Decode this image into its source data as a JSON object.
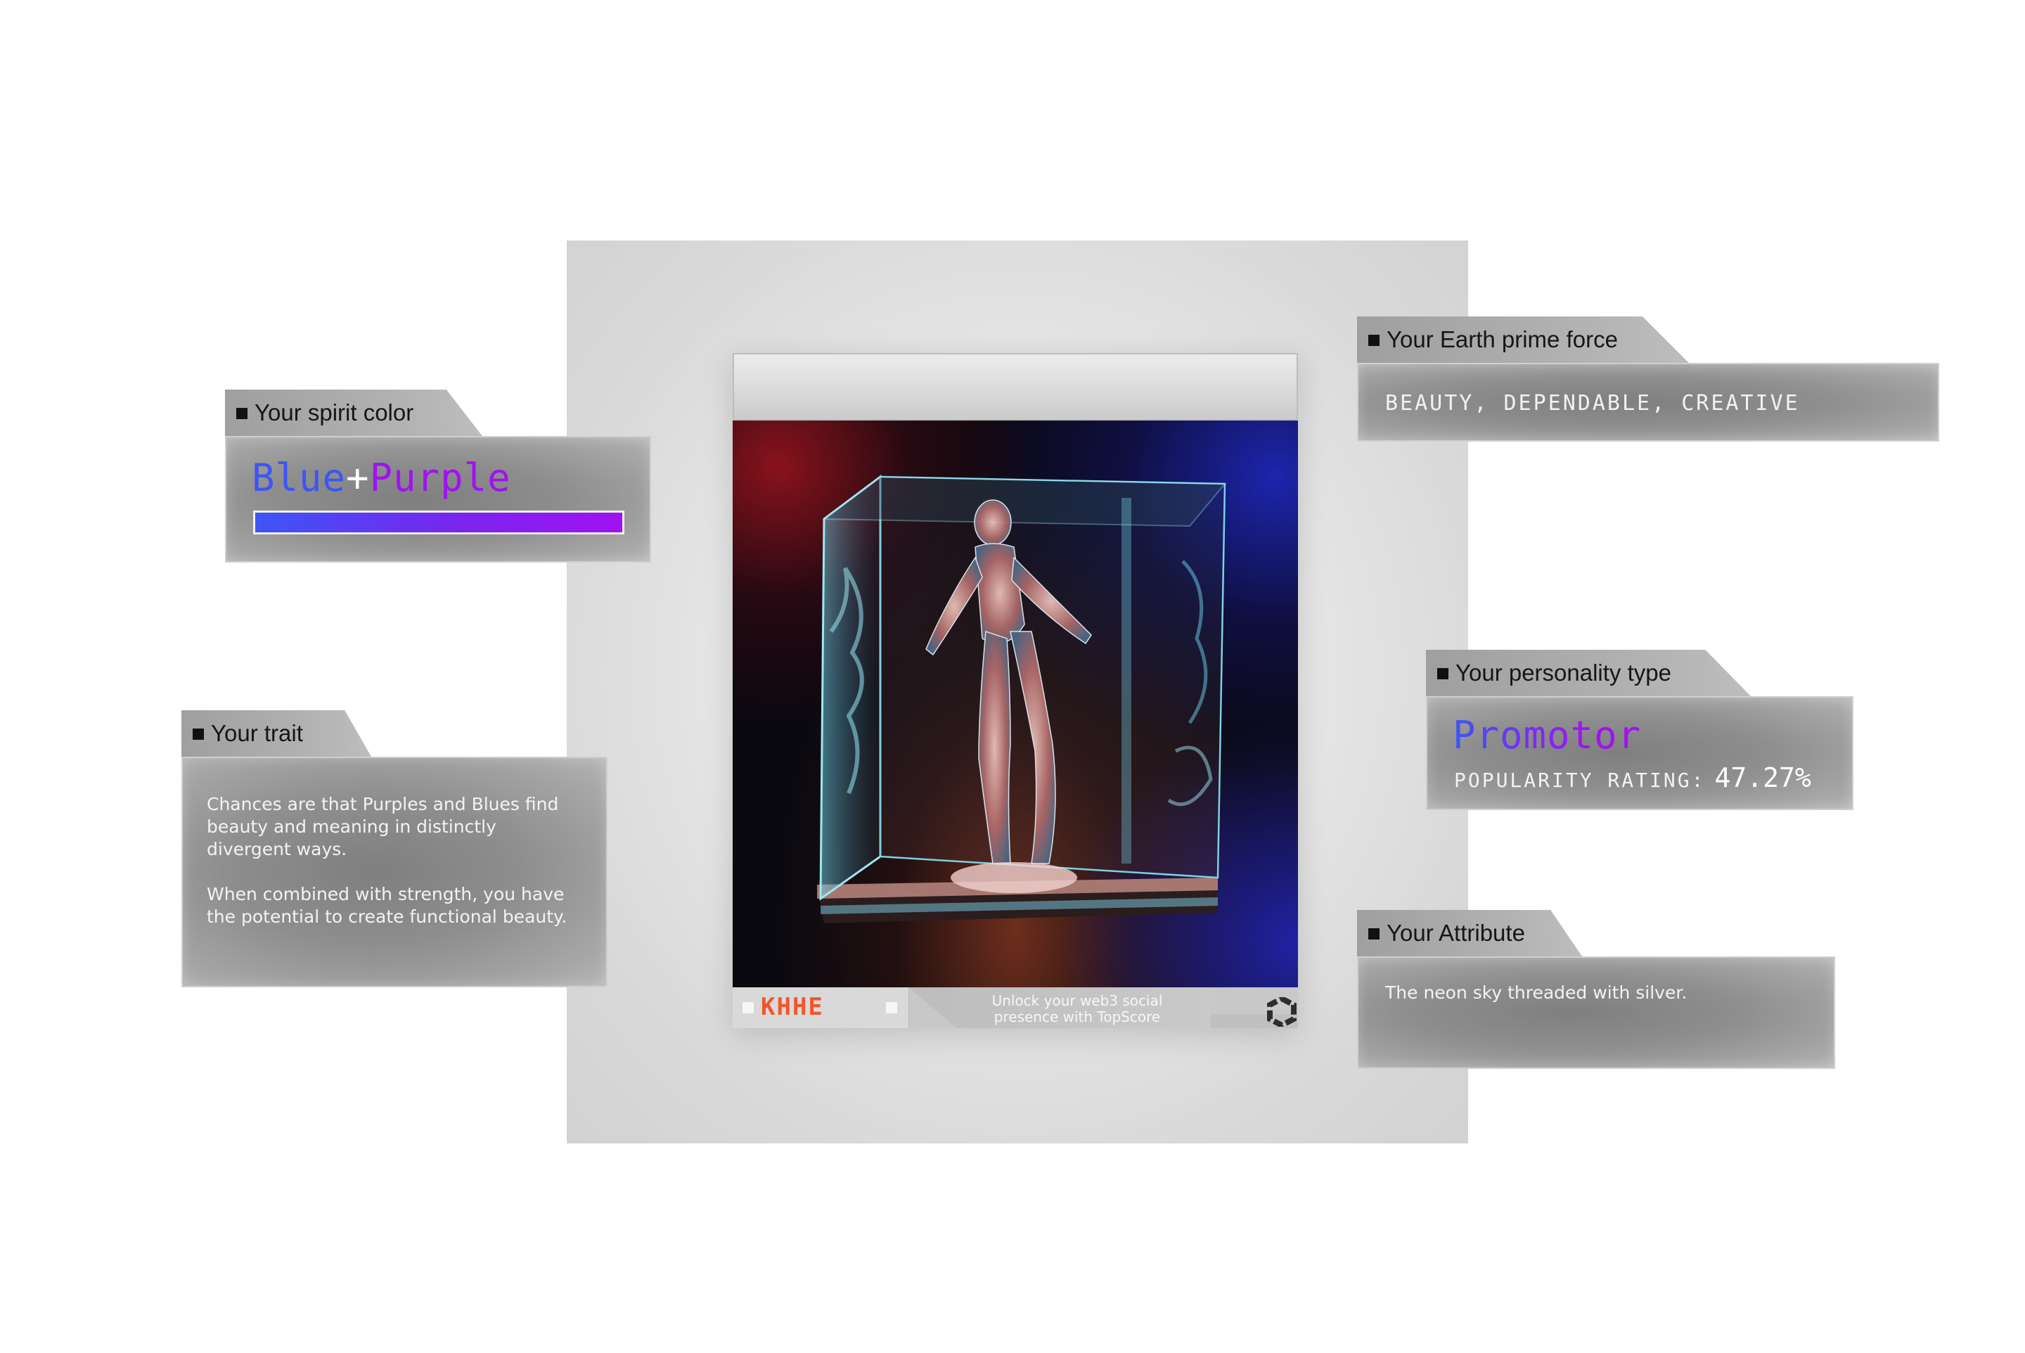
{
  "card": {
    "brand": "KHHE",
    "footer_message": "Unlock your web3 social presence with TopScore",
    "logo_icon": "hexagon-ring-icon"
  },
  "spirit_color": {
    "label": "Your spirit color",
    "color_a": "Blue",
    "plus": "+",
    "color_b": "Purple",
    "color_a_hex": "#3d55f5",
    "color_b_hex": "#a012f2"
  },
  "trait": {
    "label": "Your trait",
    "paragraph_1": "Chances are that Purples and Blues find beauty and meaning in distinctly divergent ways.",
    "paragraph_2": "When combined with strength, you have the potential to create functional beauty."
  },
  "earth_prime_force": {
    "label": "Your Earth prime force",
    "value": "BEAUTY, DEPENDABLE, CREATIVE"
  },
  "personality_type": {
    "label": "Your personality type",
    "value": "Promotor",
    "popularity_label": "POPULARITY RATING:",
    "popularity_value": "47.27%"
  },
  "attribute": {
    "label": "Your Attribute",
    "value": "The neon sky threaded with silver."
  }
}
